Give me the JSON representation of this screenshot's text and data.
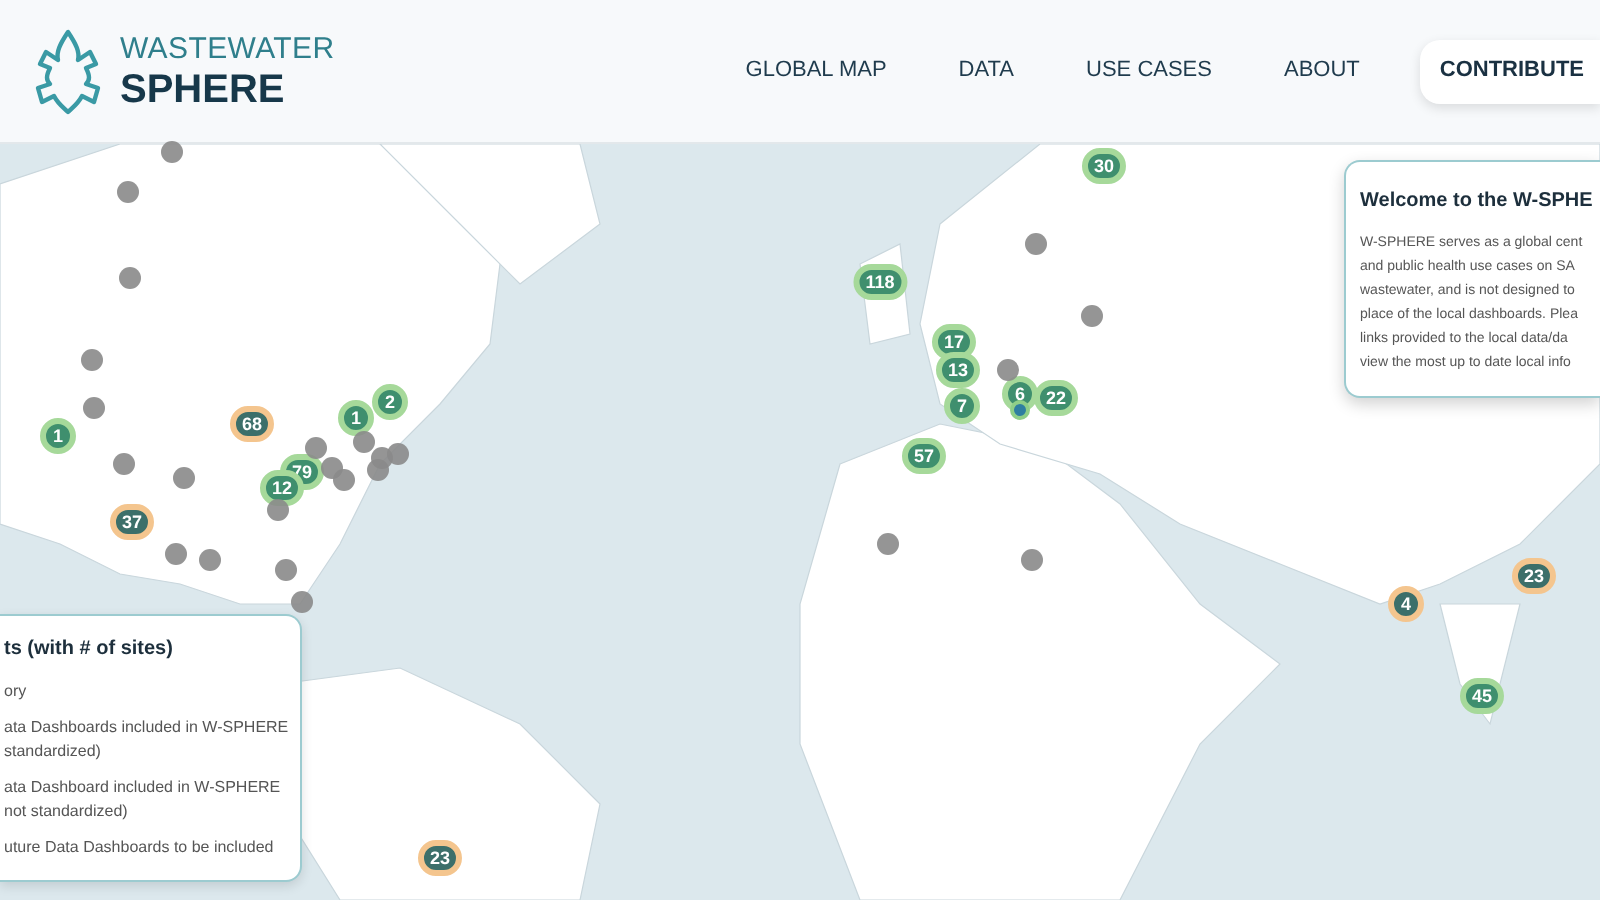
{
  "header": {
    "logo_top": "WASTEWATER",
    "logo_bottom": "SPHERE",
    "nav": [
      {
        "label": "GLOBAL MAP",
        "kind": "link"
      },
      {
        "label": "DATA",
        "kind": "link"
      },
      {
        "label": "USE CASES",
        "kind": "link"
      },
      {
        "label": "ABOUT",
        "kind": "link"
      },
      {
        "label": "CONTRIBUTE",
        "kind": "button"
      }
    ]
  },
  "map": {
    "markers": [
      {
        "kind": "dashboard",
        "count": "1"
      },
      {
        "kind": "dashboard",
        "count": "2"
      },
      {
        "kind": "dashboard",
        "count": "1"
      },
      {
        "kind": "dashboard",
        "count": "79"
      },
      {
        "kind": "dashboard",
        "count": "12"
      },
      {
        "kind": "dashboard",
        "count": "30"
      },
      {
        "kind": "dashboard",
        "count": "118"
      },
      {
        "kind": "dashboard",
        "count": "17"
      },
      {
        "kind": "dashboard",
        "count": "13"
      },
      {
        "kind": "dashboard",
        "count": "7"
      },
      {
        "kind": "dashboard",
        "count": "6"
      },
      {
        "kind": "dashboard",
        "count": "22"
      },
      {
        "kind": "dashboard",
        "count": "57"
      },
      {
        "kind": "dashboard",
        "count": "45"
      },
      {
        "kind": "future",
        "count": "68"
      },
      {
        "kind": "future",
        "count": "37"
      },
      {
        "kind": "future",
        "count": "23"
      },
      {
        "kind": "future",
        "count": "4"
      },
      {
        "kind": "future",
        "count": "23"
      },
      {
        "kind": "point"
      },
      {
        "kind": "site"
      },
      {
        "kind": "site"
      },
      {
        "kind": "site"
      },
      {
        "kind": "site"
      },
      {
        "kind": "site"
      },
      {
        "kind": "site"
      },
      {
        "kind": "site"
      },
      {
        "kind": "site"
      },
      {
        "kind": "site"
      },
      {
        "kind": "site"
      },
      {
        "kind": "site"
      },
      {
        "kind": "site"
      },
      {
        "kind": "site"
      },
      {
        "kind": "site"
      },
      {
        "kind": "site"
      },
      {
        "kind": "site"
      },
      {
        "kind": "site"
      },
      {
        "kind": "site"
      },
      {
        "kind": "site"
      },
      {
        "kind": "site"
      },
      {
        "kind": "site"
      },
      {
        "kind": "site"
      },
      {
        "kind": "site"
      },
      {
        "kind": "site"
      }
    ]
  },
  "legend": {
    "title": "ts (with # of sites)",
    "items": [
      {
        "lines": [
          "ory"
        ]
      },
      {
        "lines": [
          "ata Dashboards included in W-SPHERE",
          "standardized)"
        ]
      },
      {
        "lines": [
          "ata Dashboard included in W-SPHERE",
          "not standardized)"
        ]
      },
      {
        "lines": [
          "uture Data Dashboards to be included"
        ]
      }
    ]
  },
  "welcome": {
    "title": "Welcome to the W-SPHE",
    "lines": [
      "W-SPHERE serves as a global cent",
      "and public health use cases on SA",
      "wastewater, and is not designed to",
      "place of the local dashboards. Plea",
      "links provided to the local data/da",
      "view the most up to date local info"
    ]
  }
}
